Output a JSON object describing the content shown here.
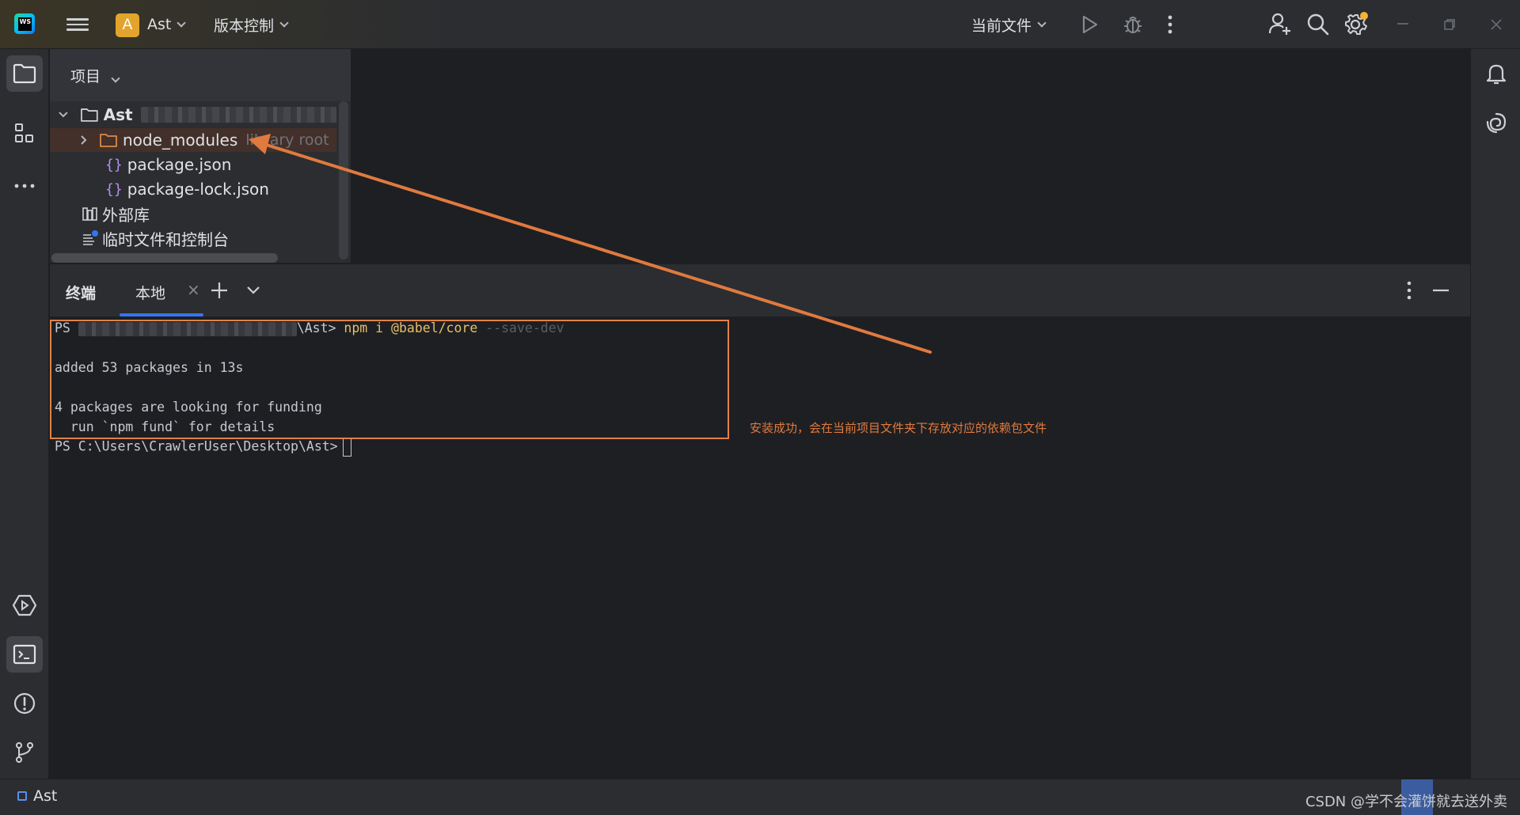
{
  "titlebar": {
    "project_badge": "A",
    "project_name": "Ast",
    "vcs_label": "版本控制",
    "run_config_label": "当前文件"
  },
  "project_panel": {
    "header": "项目",
    "tree": {
      "root": "Ast",
      "node_modules": "node_modules",
      "node_modules_hint": "library root",
      "package_json": "package.json",
      "package_lock": "package-lock.json",
      "external_libs": "外部库",
      "scratches": "临时文件和控制台"
    }
  },
  "terminal": {
    "title": "终端",
    "tab_label": "本地",
    "tab_close": "×",
    "lines": {
      "l1_prefix": "PS ",
      "l1_path_end": "\\Ast> ",
      "l1_cmd": "npm i @babel/core ",
      "l1_flag": "--save-dev",
      "l2": "added 53 packages in 13s",
      "l3": "4 packages are looking for funding",
      "l4": "  run `npm fund` for details",
      "l5": "PS C:\\Users\\CrawlerUser\\Desktop\\Ast>"
    },
    "annotation": "安装成功，会在当前项目文件夹下存放对应的依赖包文件"
  },
  "statusbar": {
    "project": "Ast",
    "watermark": "CSDN @学不会灌饼就去送外卖"
  },
  "colors": {
    "accent": "#3574f0",
    "annotation": "#e07a3f",
    "project_badge": "#e3a42d"
  }
}
